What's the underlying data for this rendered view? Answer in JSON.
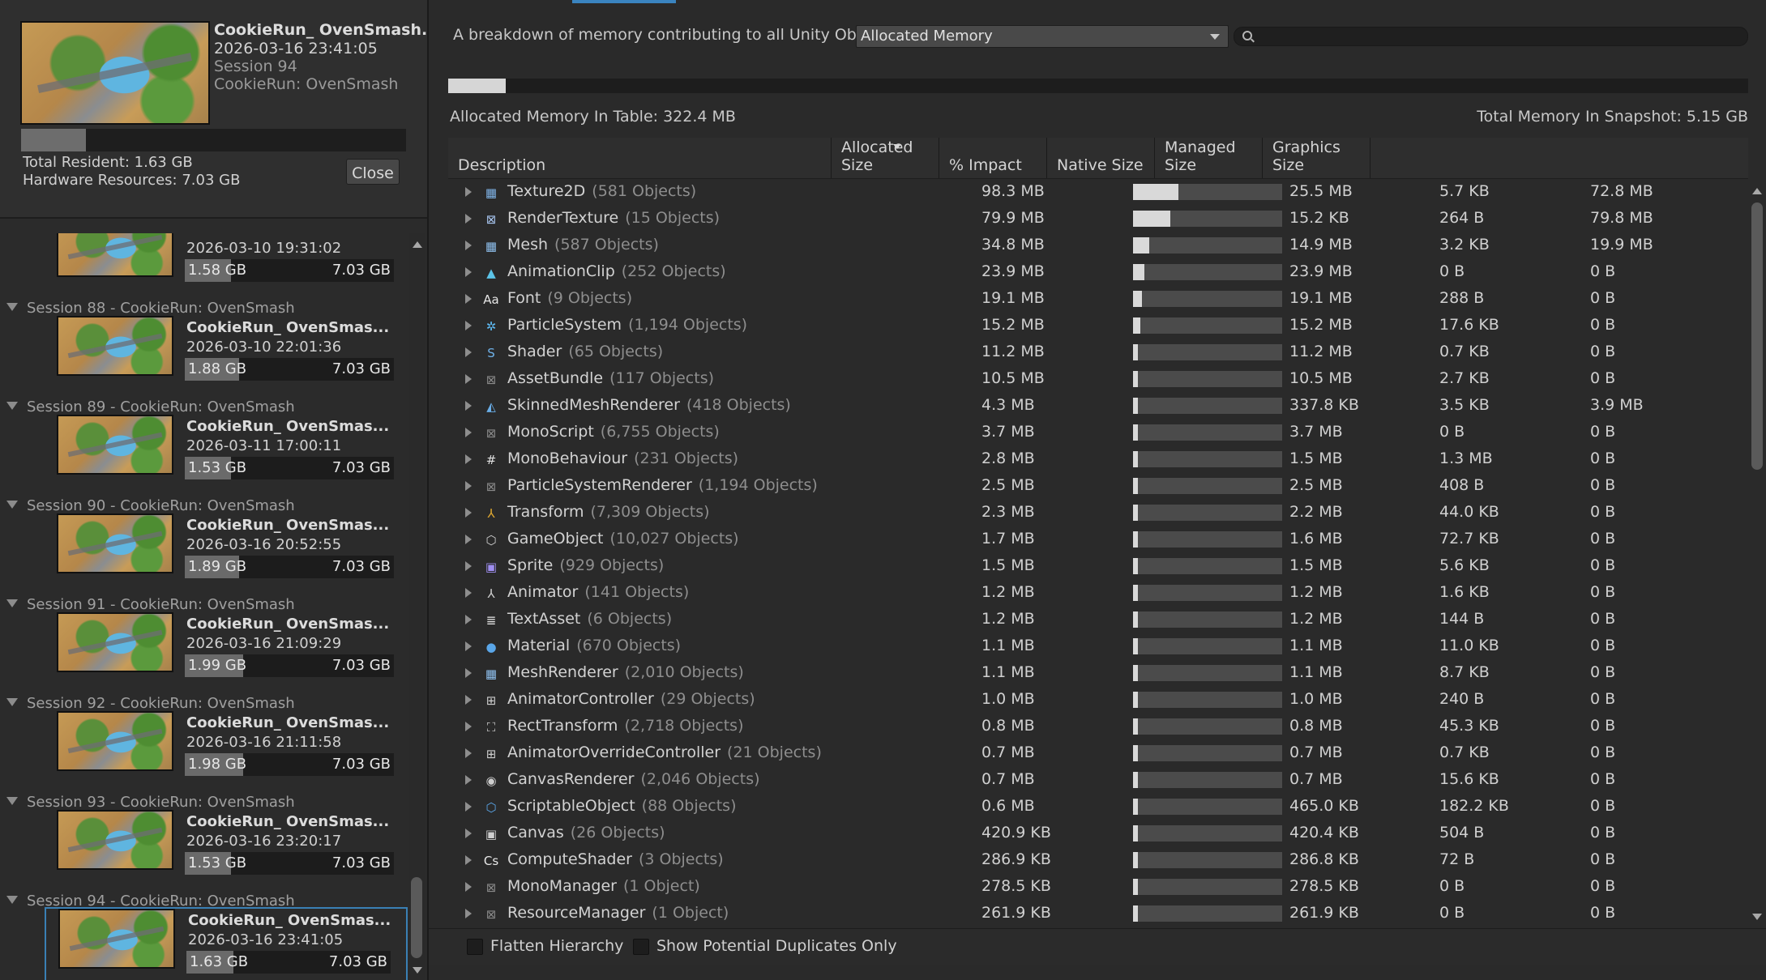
{
  "current_snapshot": {
    "title": "CookieRun_ OvenSmash...",
    "date": "2026-03-16 23:41:05",
    "session": "Session 94",
    "project": "CookieRun: OvenSmash",
    "usage_fraction": 0.168,
    "total_resident": "Total Resident: 1.63 GB",
    "hardware_resources": "Hardware Resources: 7.03 GB",
    "close_label": "Close"
  },
  "snapshot_list": [
    {
      "kind": "partial",
      "date": "2026-03-10 19:31:02",
      "used": "1.58 GB",
      "total": "7.03 GB",
      "fraction": 0.22
    },
    {
      "kind": "header",
      "label": "Session 88 - CookieRun: OvenSmash"
    },
    {
      "kind": "snap",
      "title": "CookieRun_ OvenSmas...",
      "date": "2026-03-10 22:01:36",
      "used": "1.88 GB",
      "total": "7.03 GB",
      "fraction": 0.26
    },
    {
      "kind": "header",
      "label": "Session 89 - CookieRun: OvenSmash"
    },
    {
      "kind": "snap",
      "title": "CookieRun_ OvenSmas...",
      "date": "2026-03-11 17:00:11",
      "used": "1.53 GB",
      "total": "7.03 GB",
      "fraction": 0.22
    },
    {
      "kind": "header",
      "label": "Session 90 - CookieRun: OvenSmash"
    },
    {
      "kind": "snap",
      "title": "CookieRun_ OvenSmas...",
      "date": "2026-03-16 20:52:55",
      "used": "1.89 GB",
      "total": "7.03 GB",
      "fraction": 0.26
    },
    {
      "kind": "header",
      "label": "Session 91 - CookieRun: OvenSmash"
    },
    {
      "kind": "snap",
      "title": "CookieRun_ OvenSmas...",
      "date": "2026-03-16 21:09:29",
      "used": "1.99 GB",
      "total": "7.03 GB",
      "fraction": 0.28
    },
    {
      "kind": "header",
      "label": "Session 92 - CookieRun: OvenSmash"
    },
    {
      "kind": "snap",
      "title": "CookieRun_ OvenSmas...",
      "date": "2026-03-16 21:11:58",
      "used": "1.98 GB",
      "total": "7.03 GB",
      "fraction": 0.28
    },
    {
      "kind": "header",
      "label": "Session 93 - CookieRun: OvenSmash"
    },
    {
      "kind": "snap",
      "title": "CookieRun_ OvenSmas...",
      "date": "2026-03-16 23:20:17",
      "used": "1.53 GB",
      "total": "7.03 GB",
      "fraction": 0.22
    },
    {
      "kind": "header",
      "label": "Session 94 - CookieRun: OvenSmash"
    },
    {
      "kind": "snap",
      "title": "CookieRun_ OvenSmas...",
      "date": "2026-03-16 23:41:05",
      "used": "1.63 GB",
      "total": "7.03 GB",
      "fraction": 0.23,
      "selected": true
    }
  ],
  "header": {
    "description": "A breakdown of memory contributing to all Unity Objects.",
    "dropdown_value": "Allocated Memory",
    "search_value": "",
    "table_fraction": 0.044,
    "allocated_in_table": "Allocated Memory In Table: 322.4 MB",
    "total_in_snapshot": "Total Memory In Snapshot: 5.15 GB"
  },
  "columns": [
    "Description",
    "Allocated Size",
    "% Impact",
    "Native Size",
    "Managed Size",
    "Graphics Size"
  ],
  "rows": [
    {
      "name": "Texture2D",
      "count": "(581 Objects)",
      "allocated": "98.3 MB",
      "impact": 0.305,
      "native": "25.5 MB",
      "managed": "5.7 KB",
      "graphics": "72.8 MB",
      "icon": "texture-icon",
      "glyph": "▦",
      "color": "#7fb3e6"
    },
    {
      "name": "RenderTexture",
      "count": "(15 Objects)",
      "allocated": "79.9 MB",
      "impact": 0.248,
      "native": "15.2 KB",
      "managed": "264 B",
      "graphics": "79.8 MB",
      "icon": "render-texture-icon",
      "glyph": "⊠",
      "color": "#a9c7f2"
    },
    {
      "name": "Mesh",
      "count": "(587 Objects)",
      "allocated": "34.8 MB",
      "impact": 0.108,
      "native": "14.9 MB",
      "managed": "3.2 KB",
      "graphics": "19.9 MB",
      "icon": "mesh-icon",
      "glyph": "▦",
      "color": "#8fc0ee"
    },
    {
      "name": "AnimationClip",
      "count": "(252 Objects)",
      "allocated": "23.9 MB",
      "impact": 0.074,
      "native": "23.9 MB",
      "managed": "0 B",
      "graphics": "0 B",
      "icon": "animation-clip-icon",
      "glyph": "▲",
      "color": "#5cc4e8"
    },
    {
      "name": "Font",
      "count": "(9 Objects)",
      "allocated": "19.1 MB",
      "impact": 0.059,
      "native": "19.1 MB",
      "managed": "288 B",
      "graphics": "0 B",
      "icon": "font-icon",
      "glyph": "Aa",
      "color": "#e6e6e6"
    },
    {
      "name": "ParticleSystem",
      "count": "(1,194 Objects)",
      "allocated": "15.2 MB",
      "impact": 0.047,
      "native": "15.2 MB",
      "managed": "17.6 KB",
      "graphics": "0 B",
      "icon": "particle-system-icon",
      "glyph": "✲",
      "color": "#5db8f0"
    },
    {
      "name": "Shader",
      "count": "(65 Objects)",
      "allocated": "11.2 MB",
      "impact": 0.035,
      "native": "11.2 MB",
      "managed": "0.7 KB",
      "graphics": "0 B",
      "icon": "shader-icon",
      "glyph": "S",
      "color": "#6fb1e8"
    },
    {
      "name": "AssetBundle",
      "count": "(117 Objects)",
      "allocated": "10.5 MB",
      "impact": 0.033,
      "native": "10.5 MB",
      "managed": "2.7 KB",
      "graphics": "0 B",
      "icon": "asset-bundle-icon",
      "glyph": "⊠",
      "color": "#8a8a8a"
    },
    {
      "name": "SkinnedMeshRenderer",
      "count": "(418 Objects)",
      "allocated": "4.3 MB",
      "impact": 0.013,
      "native": "337.8 KB",
      "managed": "3.5 KB",
      "graphics": "3.9 MB",
      "icon": "skinned-mesh-renderer-icon",
      "glyph": "◭",
      "color": "#6aaee8"
    },
    {
      "name": "MonoScript",
      "count": "(6,755 Objects)",
      "allocated": "3.7 MB",
      "impact": 0.011,
      "native": "3.7 MB",
      "managed": "0 B",
      "graphics": "0 B",
      "icon": "mono-script-icon",
      "glyph": "⊠",
      "color": "#8a8a8a"
    },
    {
      "name": "MonoBehaviour",
      "count": "(231 Objects)",
      "allocated": "2.8 MB",
      "impact": 0.009,
      "native": "1.5 MB",
      "managed": "1.3 MB",
      "graphics": "0 B",
      "icon": "mono-behaviour-icon",
      "glyph": "#",
      "color": "#e0e0e0"
    },
    {
      "name": "ParticleSystemRenderer",
      "count": "(1,194 Objects)",
      "allocated": "2.5 MB",
      "impact": 0.008,
      "native": "2.5 MB",
      "managed": "408 B",
      "graphics": "0 B",
      "icon": "particle-system-renderer-icon",
      "glyph": "⊠",
      "color": "#8a8a8a"
    },
    {
      "name": "Transform",
      "count": "(7,309 Objects)",
      "allocated": "2.3 MB",
      "impact": 0.007,
      "native": "2.2 MB",
      "managed": "44.0 KB",
      "graphics": "0 B",
      "icon": "transform-icon",
      "glyph": "⅄",
      "color": "#e0a830"
    },
    {
      "name": "GameObject",
      "count": "(10,027 Objects)",
      "allocated": "1.7 MB",
      "impact": 0.005,
      "native": "1.6 MB",
      "managed": "72.7 KB",
      "graphics": "0 B",
      "icon": "game-object-icon",
      "glyph": "⬡",
      "color": "#cfcfcf"
    },
    {
      "name": "Sprite",
      "count": "(929 Objects)",
      "allocated": "1.5 MB",
      "impact": 0.005,
      "native": "1.5 MB",
      "managed": "5.6 KB",
      "graphics": "0 B",
      "icon": "sprite-icon",
      "glyph": "▣",
      "color": "#9f8ef0"
    },
    {
      "name": "Animator",
      "count": "(141 Objects)",
      "allocated": "1.2 MB",
      "impact": 0.004,
      "native": "1.2 MB",
      "managed": "1.6 KB",
      "graphics": "0 B",
      "icon": "animator-icon",
      "glyph": "⅄",
      "color": "#cfcfcf"
    },
    {
      "name": "TextAsset",
      "count": "(6 Objects)",
      "allocated": "1.2 MB",
      "impact": 0.004,
      "native": "1.2 MB",
      "managed": "144 B",
      "graphics": "0 B",
      "icon": "text-asset-icon",
      "glyph": "≣",
      "color": "#e8e8e8"
    },
    {
      "name": "Material",
      "count": "(670 Objects)",
      "allocated": "1.1 MB",
      "impact": 0.003,
      "native": "1.1 MB",
      "managed": "11.0 KB",
      "graphics": "0 B",
      "icon": "material-icon",
      "glyph": "●",
      "color": "#5aa6e8"
    },
    {
      "name": "MeshRenderer",
      "count": "(2,010 Objects)",
      "allocated": "1.1 MB",
      "impact": 0.003,
      "native": "1.1 MB",
      "managed": "8.7 KB",
      "graphics": "0 B",
      "icon": "mesh-renderer-icon",
      "glyph": "▦",
      "color": "#8fc0ee"
    },
    {
      "name": "AnimatorController",
      "count": "(29 Objects)",
      "allocated": "1.0 MB",
      "impact": 0.003,
      "native": "1.0 MB",
      "managed": "240 B",
      "graphics": "0 B",
      "icon": "animator-controller-icon",
      "glyph": "⊞",
      "color": "#cfcfcf"
    },
    {
      "name": "RectTransform",
      "count": "(2,718 Objects)",
      "allocated": "0.8 MB",
      "impact": 0.002,
      "native": "0.8 MB",
      "managed": "45.3 KB",
      "graphics": "0 B",
      "icon": "rect-transform-icon",
      "glyph": "⛶",
      "color": "#cfcfcf"
    },
    {
      "name": "AnimatorOverrideController",
      "count": "(21 Objects)",
      "allocated": "0.7 MB",
      "impact": 0.002,
      "native": "0.7 MB",
      "managed": "0.7 KB",
      "graphics": "0 B",
      "icon": "animator-override-controller-icon",
      "glyph": "⊞",
      "color": "#cfcfcf"
    },
    {
      "name": "CanvasRenderer",
      "count": "(2,046 Objects)",
      "allocated": "0.7 MB",
      "impact": 0.002,
      "native": "0.7 MB",
      "managed": "15.6 KB",
      "graphics": "0 B",
      "icon": "canvas-renderer-icon",
      "glyph": "◉",
      "color": "#cfcfcf"
    },
    {
      "name": "ScriptableObject",
      "count": "(88 Objects)",
      "allocated": "0.6 MB",
      "impact": 0.002,
      "native": "465.0 KB",
      "managed": "182.2 KB",
      "graphics": "0 B",
      "icon": "scriptable-object-icon",
      "glyph": "⬡",
      "color": "#5aa6e8"
    },
    {
      "name": "Canvas",
      "count": "(26 Objects)",
      "allocated": "420.9 KB",
      "impact": 0.001,
      "native": "420.4 KB",
      "managed": "504 B",
      "graphics": "0 B",
      "icon": "canvas-icon",
      "glyph": "▣",
      "color": "#cfcfcf"
    },
    {
      "name": "ComputeShader",
      "count": "(3 Objects)",
      "allocated": "286.9 KB",
      "impact": 0.001,
      "native": "286.8 KB",
      "managed": "72 B",
      "graphics": "0 B",
      "icon": "compute-shader-icon",
      "glyph": "Cs",
      "color": "#e8e8e8"
    },
    {
      "name": "MonoManager",
      "count": "(1 Object)",
      "allocated": "278.5 KB",
      "impact": 0.001,
      "native": "278.5 KB",
      "managed": "0 B",
      "graphics": "0 B",
      "icon": "mono-manager-icon",
      "glyph": "⊠",
      "color": "#8a8a8a"
    },
    {
      "name": "ResourceManager",
      "count": "(1 Object)",
      "allocated": "261.9 KB",
      "impact": 0.001,
      "native": "261.9 KB",
      "managed": "0 B",
      "graphics": "0 B",
      "icon": "resource-manager-icon",
      "glyph": "⊠",
      "color": "#8a8a8a"
    }
  ],
  "footer": {
    "flatten_label": "Flatten Hierarchy",
    "duplicates_label": "Show Potential Duplicates Only"
  }
}
